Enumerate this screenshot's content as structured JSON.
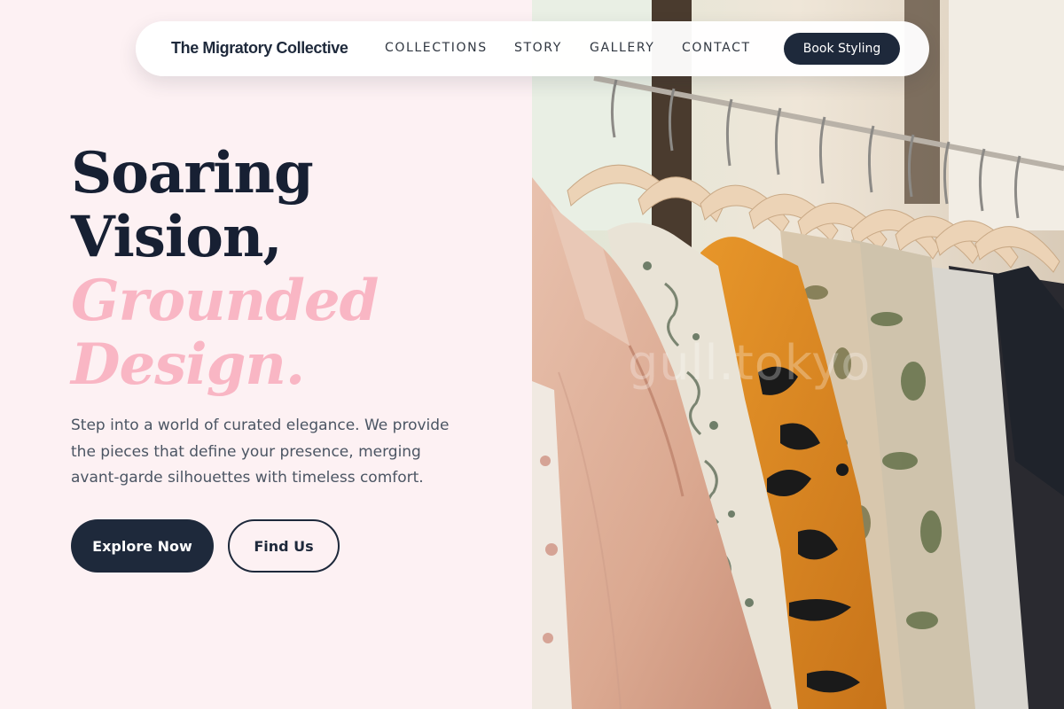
{
  "nav": {
    "brand": "The Migratory Collective",
    "links": [
      "COLLECTIONS",
      "STORY",
      "GALLERY",
      "CONTACT"
    ],
    "cta": "Book Styling"
  },
  "hero": {
    "headline": [
      "Soaring",
      "Vision,"
    ],
    "accent": [
      "Grounded",
      "Design."
    ],
    "description": "Step into a world of curated elegance. We provide the pieces that define your presence, merging avant-garde silhouettes with timeless comfort.",
    "primary_button": "Explore Now",
    "secondary_button": "Find Us"
  },
  "image": {
    "subject": "clothing rack with hanging garments",
    "watermark": "gull.tokyo"
  },
  "colors": {
    "background": "#fdf1f3",
    "navy": "#1e293b",
    "accent_pink": "#f9b6c4",
    "body_text": "#4b5563"
  }
}
